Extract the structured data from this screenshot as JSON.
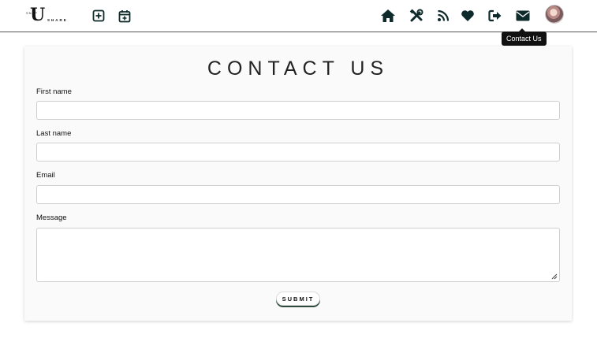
{
  "brand": {
    "logo_small": "SNAP",
    "logo_big": "U",
    "logo_share": "SHARE"
  },
  "nav": {
    "left_icons": [
      "plus-square-icon",
      "calendar-plus-icon"
    ],
    "right_icons": [
      "home-icon",
      "tools-icon",
      "rss-icon",
      "heart-icon",
      "sign-out-icon",
      "envelope-icon"
    ],
    "avatar": "user-avatar",
    "tooltip": "Contact Us"
  },
  "form": {
    "title": "CONTACT US",
    "first_name_label": "First name",
    "last_name_label": "Last name",
    "email_label": "Email",
    "message_label": "Message",
    "submit_label": "SUBMIT"
  },
  "colors": {
    "icon": "#0f2a2a",
    "tooltip_bg": "#111111",
    "submit_shadow": "#2f4a3c"
  }
}
